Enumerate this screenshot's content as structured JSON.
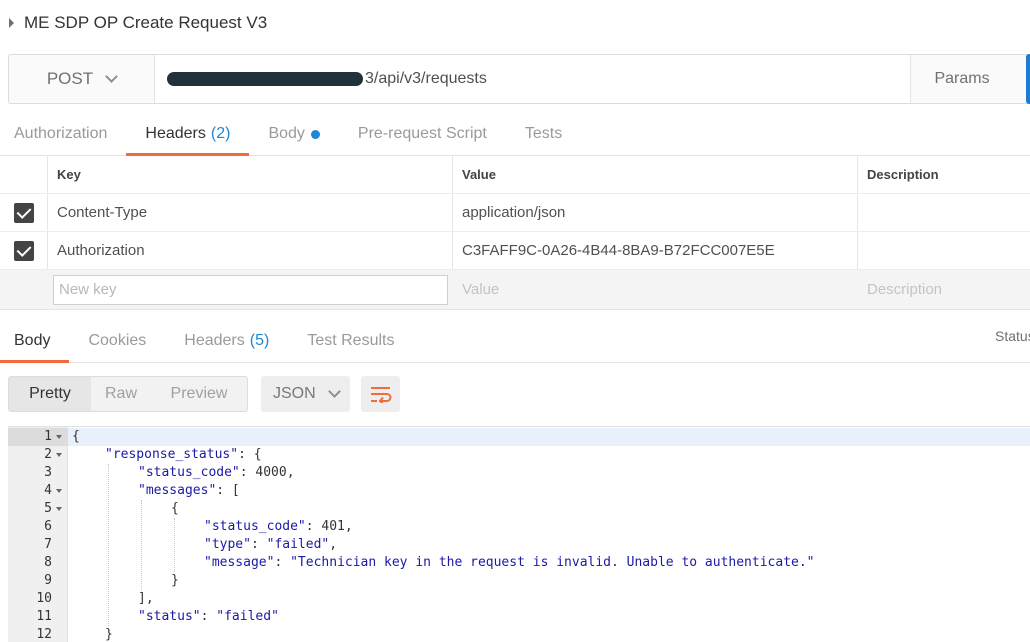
{
  "request": {
    "title": "ME SDP OP Create Request V3",
    "method": "POST",
    "url_visible": "3/api/v3/requests",
    "params_label": "Params"
  },
  "request_tabs": [
    {
      "label": "Authorization",
      "count": "",
      "active": false
    },
    {
      "label": "Headers",
      "count": "(2)",
      "active": true
    },
    {
      "label": "Body",
      "count": "",
      "active": false,
      "indicator": "dot"
    },
    {
      "label": "Pre-request Script",
      "count": "",
      "active": false
    },
    {
      "label": "Tests",
      "count": "",
      "active": false
    }
  ],
  "headers_table": {
    "columns": {
      "key": "Key",
      "value": "Value",
      "description": "Description"
    },
    "rows": [
      {
        "checked": true,
        "key": "Content-Type",
        "value": "application/json",
        "description": ""
      },
      {
        "checked": true,
        "key": "Authorization",
        "value": "C3FAFF9C-0A26-4B44-8BA9-B72FCC007E5E",
        "description": ""
      }
    ],
    "new_row": {
      "key_placeholder": "New key",
      "value_placeholder": "Value",
      "description_placeholder": "Description"
    }
  },
  "response_tabs": [
    {
      "label": "Body",
      "count": "",
      "active": true
    },
    {
      "label": "Cookies",
      "count": "",
      "active": false
    },
    {
      "label": "Headers",
      "count": "(5)",
      "active": false
    },
    {
      "label": "Test Results",
      "count": "",
      "active": false
    }
  ],
  "status_label": "Status",
  "view_modes": [
    "Pretty",
    "Raw",
    "Preview"
  ],
  "active_view": "Pretty",
  "format": "JSON",
  "wrap_icon": "wrap-lines-icon",
  "code_lines": [
    {
      "n": "1",
      "fold": true,
      "indent": 0,
      "text": "{"
    },
    {
      "n": "2",
      "fold": true,
      "indent": 1,
      "text": "\"response_status\": {"
    },
    {
      "n": "3",
      "fold": false,
      "indent": 2,
      "text": "\"status_code\": 4000,"
    },
    {
      "n": "4",
      "fold": true,
      "indent": 2,
      "text": "\"messages\": ["
    },
    {
      "n": "5",
      "fold": true,
      "indent": 3,
      "text": "{"
    },
    {
      "n": "6",
      "fold": false,
      "indent": 4,
      "text": "\"status_code\": 401,"
    },
    {
      "n": "7",
      "fold": false,
      "indent": 4,
      "text": "\"type\": \"failed\","
    },
    {
      "n": "8",
      "fold": false,
      "indent": 4,
      "text": "\"message\": \"Technician key in the request is invalid. Unable to authenticate.\""
    },
    {
      "n": "9",
      "fold": false,
      "indent": 3,
      "text": "}"
    },
    {
      "n": "10",
      "fold": false,
      "indent": 2,
      "text": "],"
    },
    {
      "n": "11",
      "fold": false,
      "indent": 2,
      "text": "\"status\": \"failed\""
    },
    {
      "n": "12",
      "fold": false,
      "indent": 1,
      "text": "}"
    }
  ],
  "colors": {
    "accent_orange": "#f26b3a",
    "accent_blue": "#1e88d6",
    "send_blue": "#1d7bd6"
  }
}
